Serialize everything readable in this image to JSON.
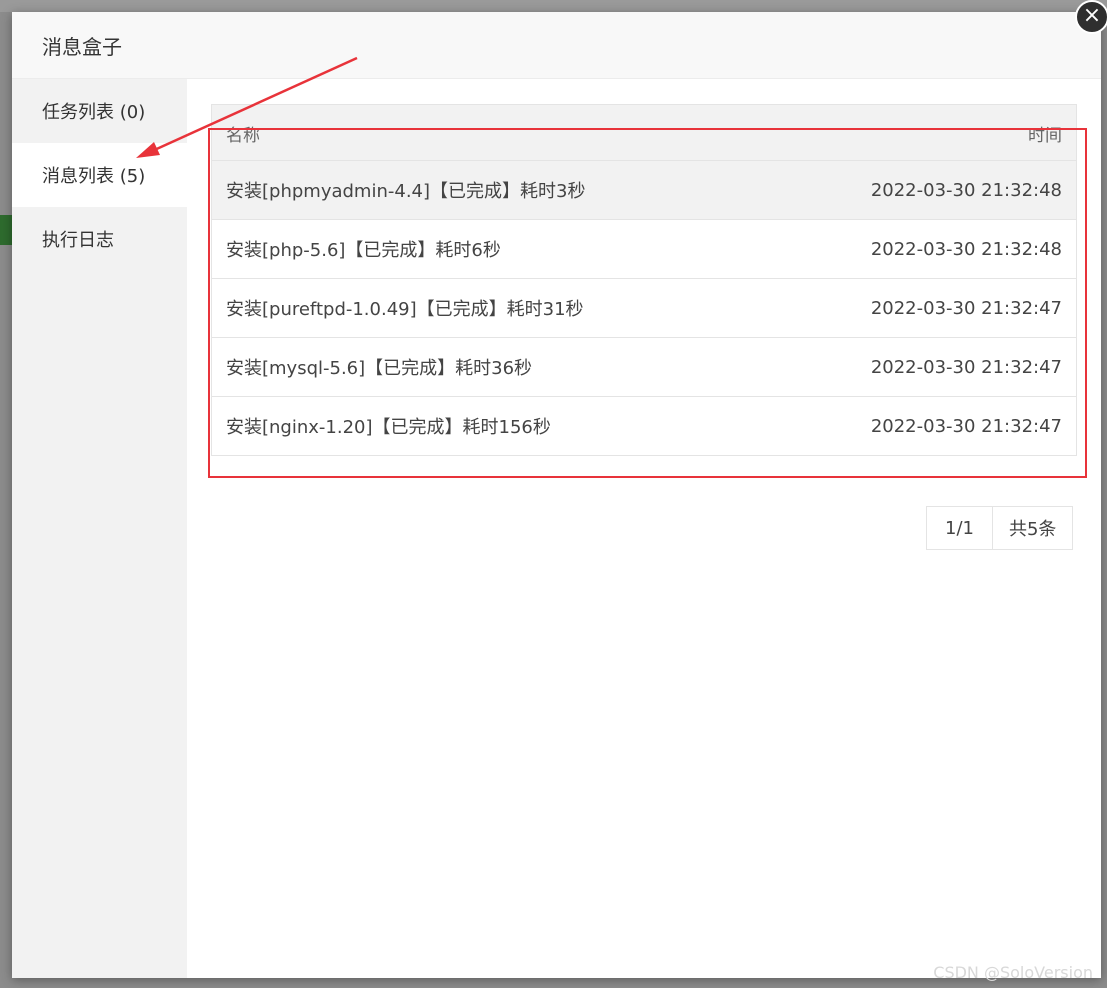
{
  "modal": {
    "title": "消息盒子",
    "close_glyph": "×"
  },
  "sidebar": {
    "items": [
      {
        "label": "任务列表 (0)"
      },
      {
        "label": "消息列表 (5)"
      },
      {
        "label": "执行日志"
      }
    ]
  },
  "table": {
    "headers": {
      "name": "名称",
      "time": "时间"
    },
    "rows": [
      {
        "name": "安装[phpmyadmin-4.4]【已完成】耗时3秒",
        "time": "2022-03-30 21:32:48"
      },
      {
        "name": "安装[php-5.6]【已完成】耗时6秒",
        "time": "2022-03-30 21:32:48"
      },
      {
        "name": "安装[pureftpd-1.0.49]【已完成】耗时31秒",
        "time": "2022-03-30 21:32:47"
      },
      {
        "name": "安装[mysql-5.6]【已完成】耗时36秒",
        "time": "2022-03-30 21:32:47"
      },
      {
        "name": "安装[nginx-1.20]【已完成】耗时156秒",
        "time": "2022-03-30 21:32:47"
      }
    ]
  },
  "pagination": {
    "page": "1/1",
    "total": "共5条"
  },
  "watermark": "CSDN @SoloVersion",
  "colors": {
    "annotation_red": "#e8333a"
  }
}
